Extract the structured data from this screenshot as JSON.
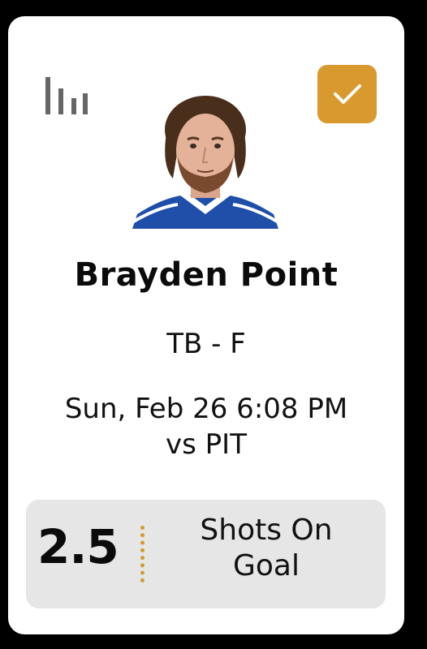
{
  "player": {
    "name": "Brayden Point",
    "team_position": "TB - F",
    "game_time": "Sun, Feb 26 6:08 PM",
    "opponent": "vs PIT"
  },
  "prop": {
    "line": "2.5",
    "stat_type_line1": "Shots On",
    "stat_type_line2": "Goal"
  },
  "icons": {
    "stats": "bar-chart-icon",
    "select": "checkmark-icon"
  },
  "colors": {
    "accent": "#d89a2f",
    "card": "#ffffff",
    "panel": "#e6e6e6",
    "background": "#000000",
    "jersey": "#1f4fa8"
  }
}
